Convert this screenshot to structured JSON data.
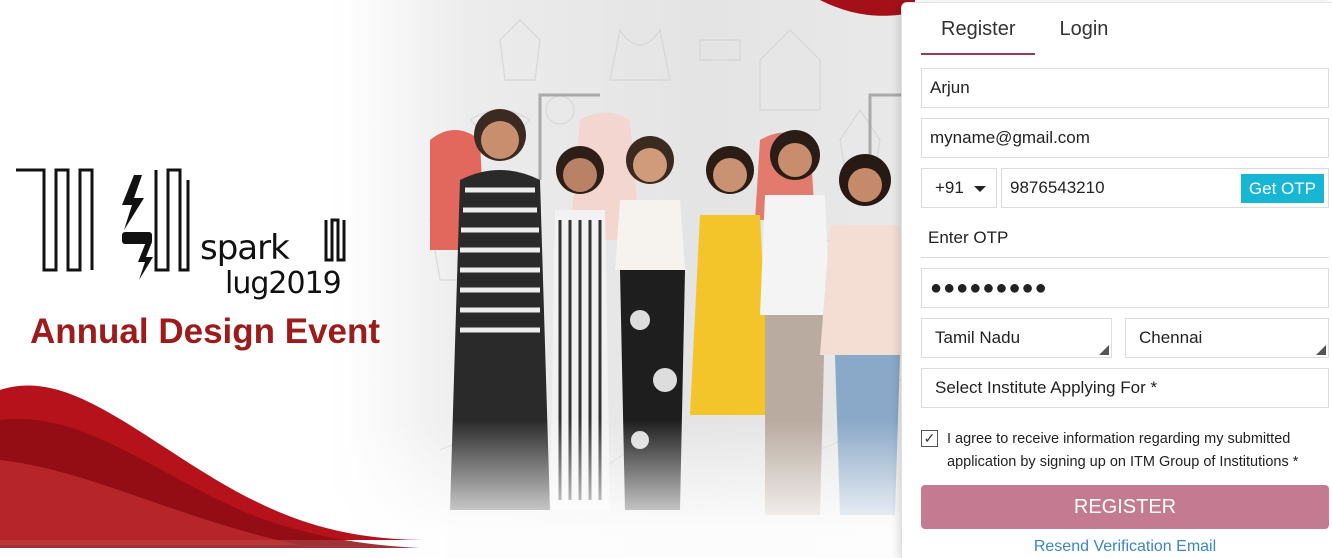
{
  "banner": {
    "logo_line1": "spark",
    "logo_line2": "lug2019",
    "event_title": "Annual Design Event"
  },
  "tabs": [
    {
      "label": "Register",
      "active": true
    },
    {
      "label": "Login",
      "active": false
    }
  ],
  "form": {
    "name_value": "Arjun",
    "email_value": "myname@gmail.com",
    "country_code": "+91",
    "phone_value": "9876543210",
    "get_otp_label": "Get OTP",
    "otp_placeholder": "Enter OTP",
    "password_masked": "●●●●●●●●●",
    "state_value": "Tamil Nadu",
    "city_value": "Chennai",
    "institute_placeholder": "Select Institute Applying For *",
    "agree_checked": true,
    "agree_text": "I agree to receive information regarding my submitted application by signing up on ITM Group of Institutions *",
    "register_label": "REGISTER",
    "resend_label": "Resend Verification Email"
  },
  "colors": {
    "accent": "#9b3a53",
    "register_button": "#c47b92",
    "otp_button": "#17b6d4",
    "event_title": "#9e1b1b",
    "link": "#3a86c8"
  }
}
